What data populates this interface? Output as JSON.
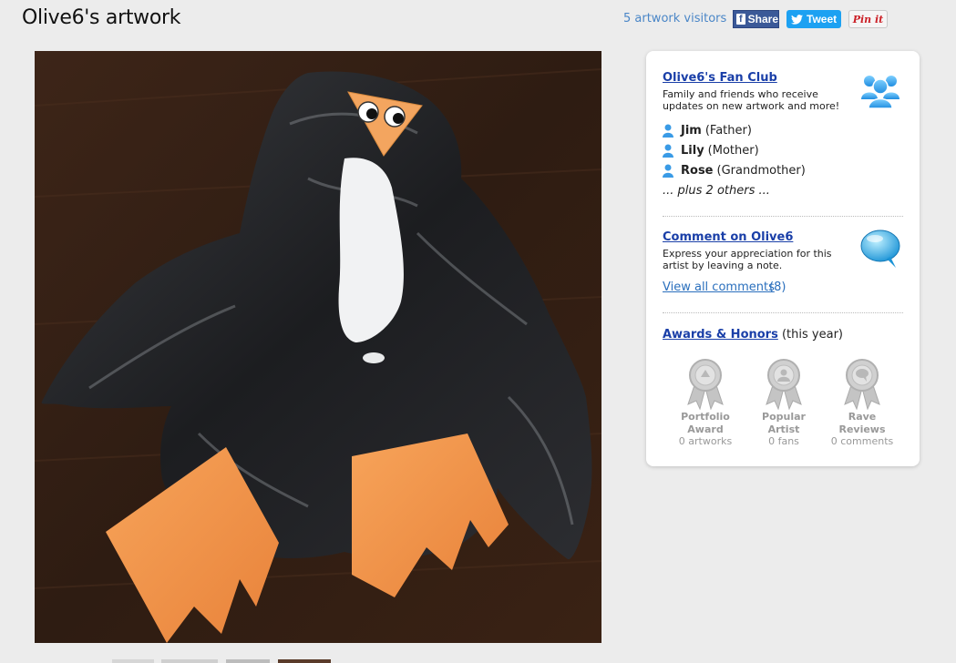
{
  "header": {
    "title": "Olive6's artwork",
    "visitors": "5 artwork visitors",
    "share_facebook": "Share",
    "share_twitter": "Tweet",
    "share_pinterest": "Pin it"
  },
  "fan_club": {
    "title": "Olive6's Fan Club",
    "description": "Family and friends who receive updates on new artwork and more!",
    "members": [
      {
        "name": "Jim",
        "relation": "(Father)"
      },
      {
        "name": "Lily",
        "relation": "(Mother)"
      },
      {
        "name": "Rose",
        "relation": "(Grandmother)"
      }
    ],
    "others": "... plus 2 others ..."
  },
  "comments": {
    "title": "Comment on Olive6",
    "description": "Express your appreciation for this artist by leaving a note.",
    "view_all": "View all comments",
    "count": "(8)"
  },
  "awards": {
    "title": "Awards & Honors",
    "period": "(this year)",
    "items": [
      {
        "name_line1": "Portfolio",
        "name_line2": "Award",
        "count": "0 artworks"
      },
      {
        "name_line1": "Popular",
        "name_line2": "Artist",
        "count": "0 fans"
      },
      {
        "name_line1": "Rave",
        "name_line2": "Reviews",
        "count": "0 comments"
      }
    ]
  },
  "colors": {
    "link": "#1a3fa8",
    "visitors": "#4a86c7",
    "facebook": "#3b5998",
    "twitter": "#1da1f2",
    "pinterest": "#cb2027",
    "award_grey": "#c4c4c4"
  }
}
